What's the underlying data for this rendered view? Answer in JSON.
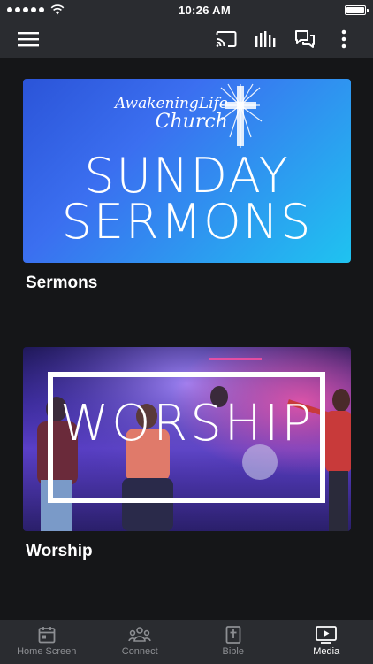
{
  "status_bar": {
    "time": "10:26 AM"
  },
  "media_items": [
    {
      "title": "Sermons",
      "thumbnail": {
        "brand_line1": "AwakeningLife",
        "brand_line2": "Church",
        "headline_line1": "SUNDAY",
        "headline_line2": "SERMONS"
      }
    },
    {
      "title": "Worship",
      "thumbnail": {
        "headline": "WORSHIP"
      }
    }
  ],
  "tabs": [
    {
      "label": "Home Screen",
      "icon": "calendar-icon",
      "active": false
    },
    {
      "label": "Connect",
      "icon": "people-icon",
      "active": false
    },
    {
      "label": "Bible",
      "icon": "bible-icon",
      "active": false
    },
    {
      "label": "Media",
      "icon": "play-screen-icon",
      "active": true
    }
  ],
  "colors": {
    "background": "#151618",
    "bars": "#2a2c30",
    "inactive_tab": "#8d8f93",
    "active_tab": "#ffffff"
  }
}
